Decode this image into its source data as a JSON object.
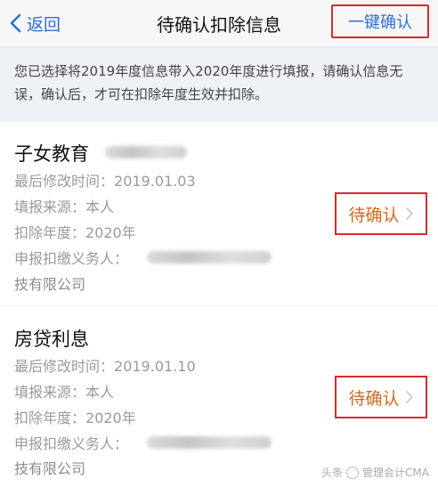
{
  "nav": {
    "back_label": "返回",
    "title": "待确认扣除信息",
    "confirm_all_label": "一键确认",
    "accent_color": "#2f6fd8",
    "highlight_border_color": "#d72c2c"
  },
  "notice": {
    "text": "您已选择将2019年度信息带入2020年度进行填报，请确认信息无误，确认后，才可在扣除年度生效并扣除。"
  },
  "sections": [
    {
      "title": "子女教育",
      "rows": [
        {
          "label": "最后修改时间：",
          "value": "2019.01.03"
        },
        {
          "label": "填报来源：",
          "value": "本人"
        },
        {
          "label": "扣除年度：",
          "value": "2020年"
        },
        {
          "label": "申报扣缴义务人：",
          "value": ""
        }
      ],
      "company_suffix": "技有限公司",
      "status_label": "待确认",
      "status_color": "#d2691e"
    },
    {
      "title": "房贷利息",
      "rows": [
        {
          "label": "最后修改时间：",
          "value": "2019.01.10"
        },
        {
          "label": "填报来源：",
          "value": "本人"
        },
        {
          "label": "扣除年度：",
          "value": "2020年"
        },
        {
          "label": "申报扣缴义务人：",
          "value": ""
        }
      ],
      "company_suffix": "技有限公司",
      "status_label": "待确认",
      "status_color": "#d2691e"
    }
  ],
  "watermark": {
    "prefix": "头条",
    "brand": "管理会计CMA"
  }
}
